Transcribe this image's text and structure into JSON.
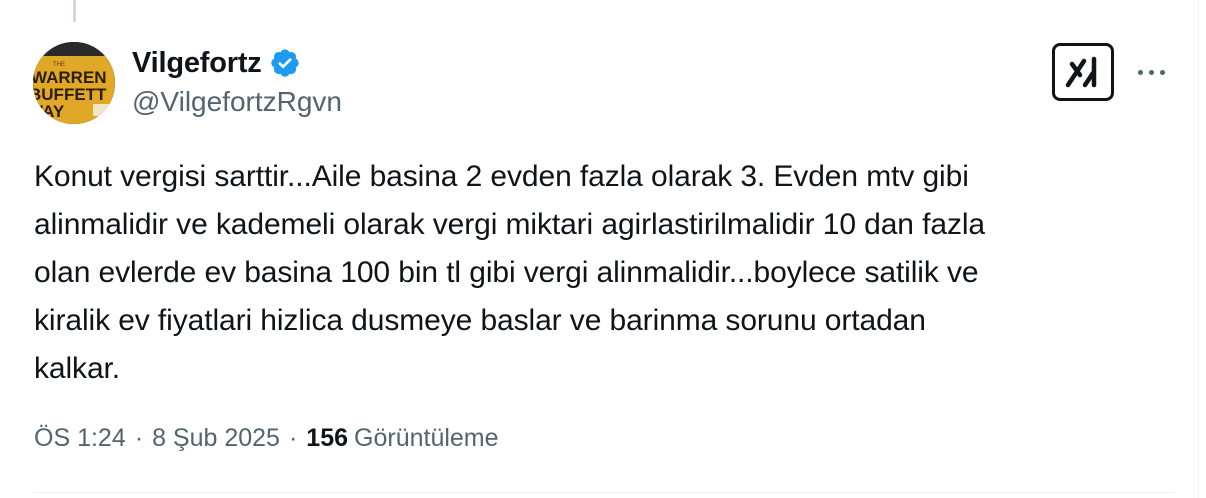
{
  "author": {
    "display_name": "Vilgefortz",
    "handle": "@VilgefortzRgvn",
    "avatar_book_title": [
      "WARREN",
      "BUFFETT",
      "WAY"
    ],
    "avatar_book_prefix": "THE",
    "verified": true,
    "verified_color": "#1d9bf0"
  },
  "tweet": {
    "lines": [
      "Konut vergisi sarttir...Aile basina 2 evden fazla olarak 3. Evden mtv gibi",
      "alinmalidir ve kademeli olarak vergi miktari agirlastirilmalidir 10 dan fazla",
      "olan evlerde ev basina 100 bin tl gibi vergi alinmalidir...boylece satilik ve",
      "kiralik ev fiyatlari hizlica dusmeye baslar ve barinma sorunu ortadan",
      "kalkar."
    ]
  },
  "meta": {
    "time": "ÖS 1:24",
    "separator": "·",
    "date": "8 Şub 2025",
    "views_count": "156",
    "views_label": "Görüntüleme"
  },
  "icons": {
    "grok": "grok-icon",
    "more": "more-options-icon",
    "verified": "verified-badge-icon"
  }
}
